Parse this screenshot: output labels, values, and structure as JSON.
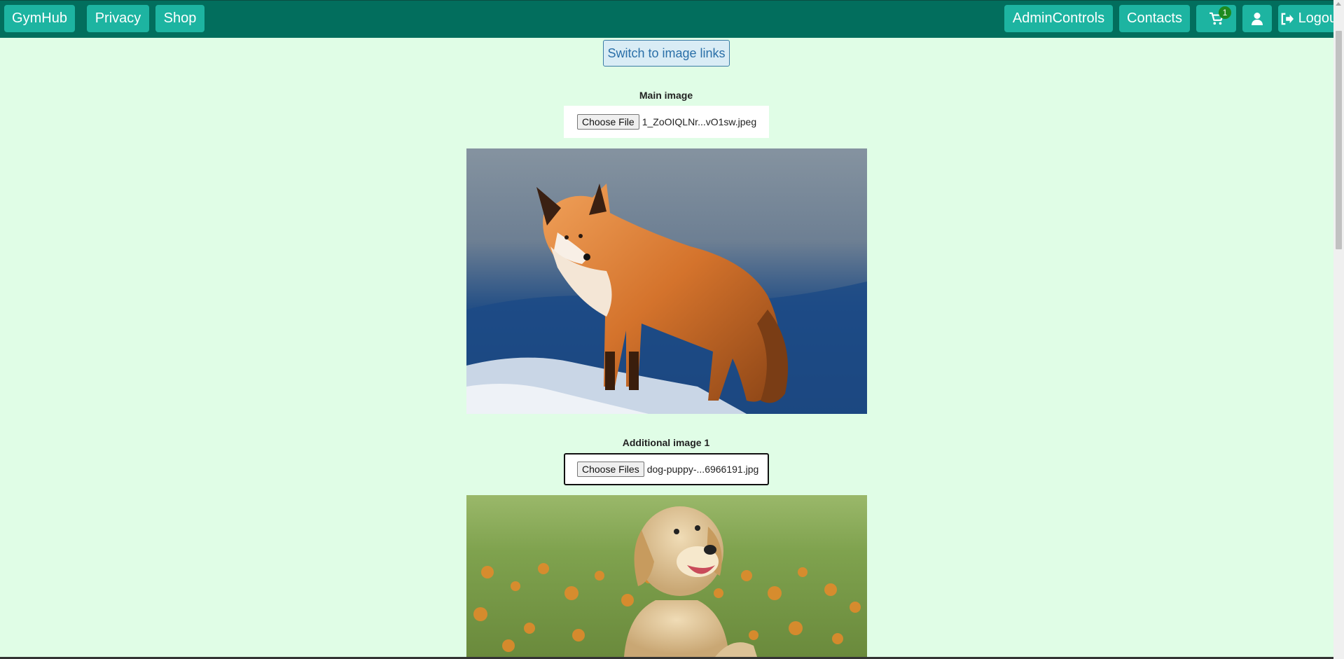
{
  "navbar": {
    "brand": "GymHub",
    "links": [
      "Privacy",
      "Shop"
    ],
    "right_links": [
      "AdminControls",
      "Contacts"
    ],
    "cart_count": "1",
    "logout_label": "Logout",
    "colors": {
      "bar": "#026e5d",
      "button": "#1db4a1"
    }
  },
  "toggle": {
    "label": "Switch to image links"
  },
  "main_image": {
    "label": "Main image",
    "button": "Choose File",
    "file_name": "1_ZoOIQLNr...vO1sw.jpeg"
  },
  "additional_image_1": {
    "label": "Additional image 1",
    "button": "Choose Files",
    "file_name": "dog-puppy-...6966191.jpg"
  },
  "icons": {
    "cart": "cart-icon",
    "user": "user-icon",
    "logout": "logout-icon"
  }
}
